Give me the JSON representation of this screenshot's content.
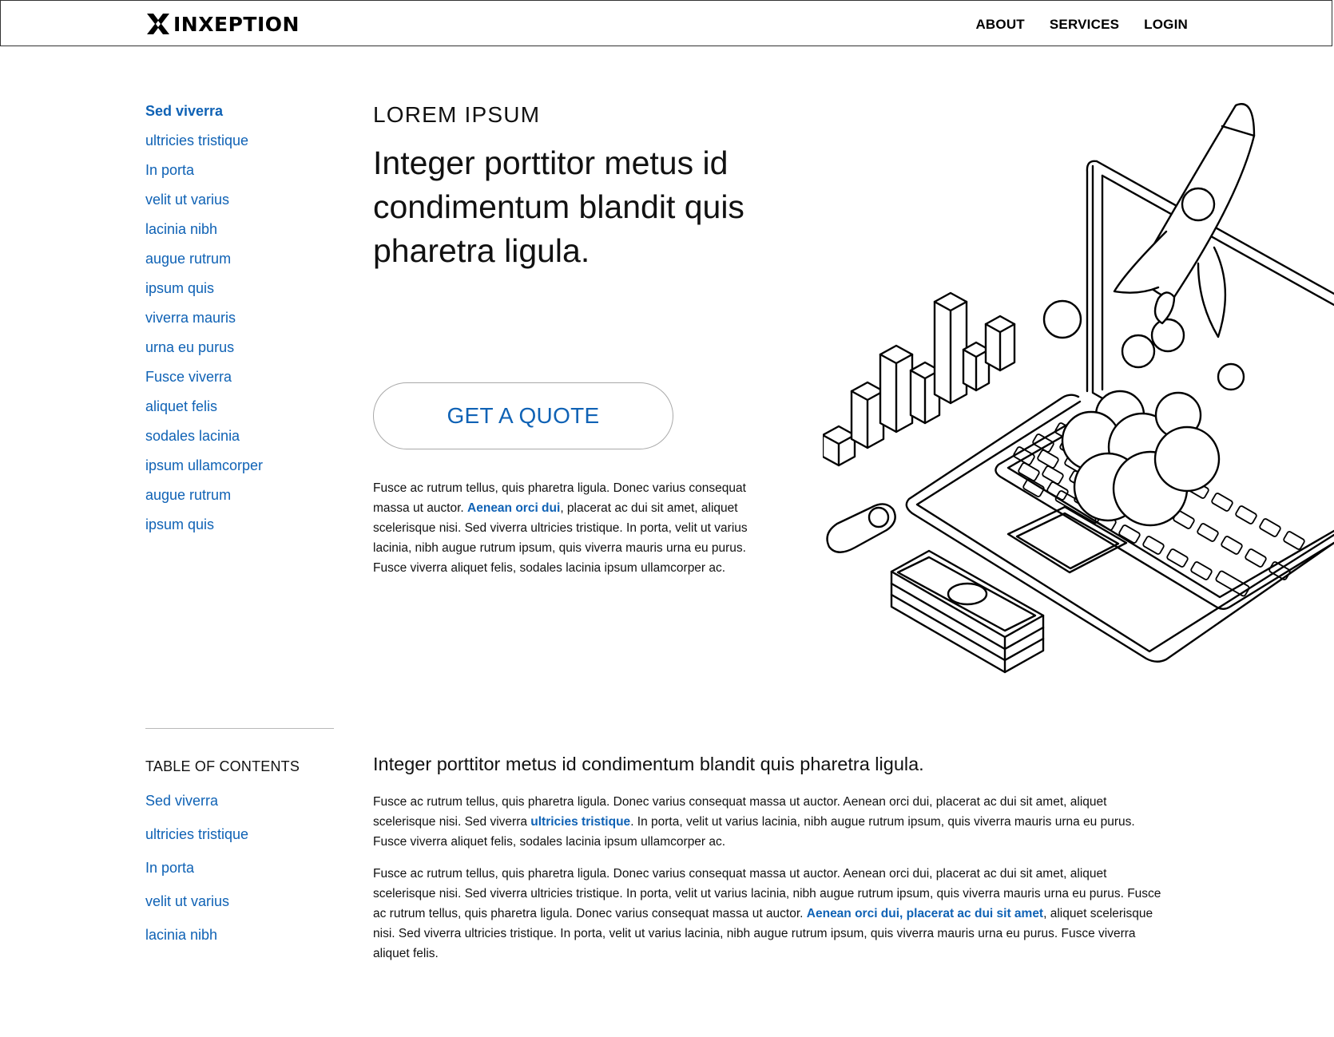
{
  "header": {
    "logo_text": "INXEPTION",
    "nav": [
      "ABOUT",
      "SERVICES",
      "LOGIN"
    ]
  },
  "sidebar": {
    "links": [
      "Sed viverra",
      "ultricies tristique",
      "In porta",
      "velit ut varius",
      "lacinia nibh",
      "augue rutrum",
      "ipsum quis",
      "viverra mauris",
      "urna eu purus",
      "Fusce viverra",
      "aliquet felis",
      "sodales lacinia",
      "ipsum ullamcorper",
      "augue rutrum",
      "ipsum quis"
    ],
    "active_index": 0
  },
  "toc": {
    "title": "TABLE OF CONTENTS",
    "links": [
      "Sed viverra",
      "ultricies tristique",
      "In porta",
      "velit ut varius",
      "lacinia nibh"
    ]
  },
  "hero": {
    "eyebrow": "LOREM IPSUM",
    "title": "Integer porttitor metus id condimentum blandit quis pharetra ligula.",
    "cta_label": "GET A QUOTE",
    "para_before": "Fusce ac rutrum tellus, quis pharetra ligula. Donec varius consequat massa ut auctor. ",
    "para_link": "Aenean orci dui",
    "para_after": ", placerat ac dui sit amet, aliquet scelerisque nisi. Sed viverra ultricies tristique. In porta, velit ut varius lacinia, nibh augue rutrum ipsum, quis viverra mauris urna eu purus. Fusce viverra aliquet felis, sodales lacinia ipsum ullamcorper ac."
  },
  "article": {
    "title": "Integer porttitor metus id condimentum blandit quis pharetra ligula.",
    "p1_before": "Fusce ac rutrum tellus, quis pharetra ligula. Donec varius consequat massa ut auctor. Aenean orci dui, placerat ac dui sit amet, aliquet scelerisque nisi. Sed viverra ",
    "p1_link": "ultricies tristique",
    "p1_after": ". In porta, velit ut varius lacinia, nibh augue rutrum ipsum, quis viverra mauris urna eu purus. Fusce viverra aliquet felis, sodales lacinia ipsum ullamcorper ac.",
    "p2_before": "Fusce ac rutrum tellus, quis pharetra ligula. Donec varius consequat massa ut auctor. Aenean orci dui, placerat ac dui sit amet, aliquet scelerisque nisi. Sed viverra ultricies tristique. In porta, velit ut varius lacinia, nibh augue rutrum ipsum, quis viverra mauris urna eu purus. Fusce ac rutrum tellus, quis pharetra ligula. Donec varius consequat massa ut auctor. ",
    "p2_link": "Aenean orci dui, placerat ac dui sit amet",
    "p2_after": ", aliquet scelerisque nisi. Sed viverra ultricies tristique. In porta, velit ut varius lacinia, nibh augue rutrum ipsum, quis viverra mauris urna eu purus. Fusce viverra aliquet felis."
  },
  "colors": {
    "link": "#0f62b5",
    "text": "#111111",
    "border": "#333333"
  },
  "icons": {
    "logo": "x-logo-icon",
    "illustration": "laptop-rocket-chart-illustration"
  }
}
